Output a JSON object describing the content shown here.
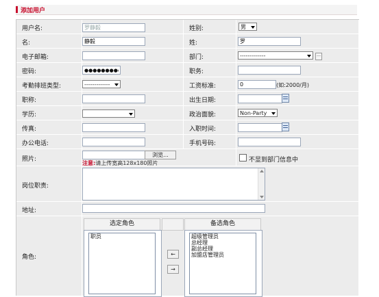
{
  "page_title": "添加用户",
  "fields": {
    "username_label": "用户名:",
    "username_value": "罗静毅",
    "gender_label": "姓别:",
    "gender_value": "男",
    "firstname_label": "名:",
    "firstname_value": "静毅",
    "lastname_label": "姓:",
    "lastname_value": "罗",
    "email_label": "电子邮箱:",
    "email_value": "",
    "dept_label": "部门:",
    "dept_value": "-------------",
    "password_label": "密码:",
    "password_value": "●●●●●●●●●",
    "post_label": "职务:",
    "post_value": "",
    "attendance_label": "考勤排班类型:",
    "attendance_value": "-------------",
    "salary_label": "工资标准:",
    "salary_value": "0",
    "salary_hint": "(如:2000/月)",
    "title_label": "职称:",
    "title_value": "",
    "birth_label": "出生日期:",
    "birth_value": "",
    "education_label": "学历:",
    "education_value": "",
    "political_label": "政治面貌:",
    "political_value": "Non-Party",
    "fax_label": "传真:",
    "fax_value": "",
    "join_label": "入职时间:",
    "join_value": "",
    "officephone_label": "办公电话:",
    "officephone_value": "",
    "mobile_label": "手机号码:",
    "mobile_value": "",
    "photo_label": "照片:",
    "browse_label": "浏览...",
    "photo_note_prefix": "注意:",
    "photo_note": "请上传宽高128x180照片",
    "hide_dept_label": "不显到部门信息中",
    "duty_label": "岗位职责:",
    "address_label": "地址:",
    "role_label": "角色:"
  },
  "roles": {
    "selected_header": "选定角色",
    "available_header": "备选角色",
    "selected": [
      "职员"
    ],
    "available": [
      "超级管理员",
      "总经理",
      "副总经理",
      "加盟店管理员"
    ],
    "move_left": "←",
    "move_right": "→"
  }
}
